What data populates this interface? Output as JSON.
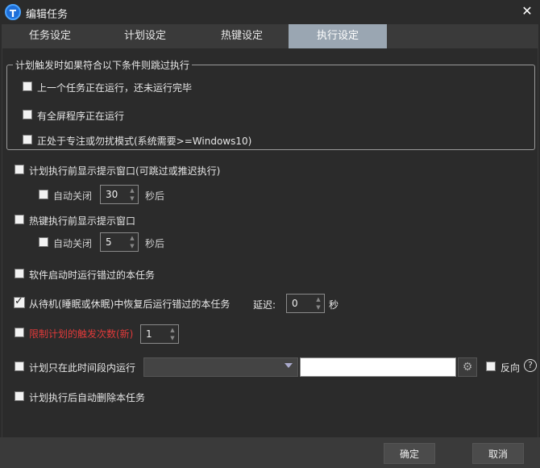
{
  "window": {
    "title": "编辑任务",
    "app_icon_letter": "T",
    "close_glyph": "✕"
  },
  "tabs": [
    {
      "label": "任务设定",
      "active": false
    },
    {
      "label": "计划设定",
      "active": false
    },
    {
      "label": "热键设定",
      "active": false
    },
    {
      "label": "执行设定",
      "active": true
    }
  ],
  "skip_group": {
    "legend": "计划触发时如果符合以下条件则跳过执行",
    "options": [
      {
        "label": "上一个任务正在运行，还未运行完毕",
        "checked": false
      },
      {
        "label": "有全屏程序正在运行",
        "checked": false
      },
      {
        "label": "正处于专注或勿扰模式(系统需要>=Windows10)",
        "checked": false
      }
    ]
  },
  "show_prompt_before_plan": {
    "label": "计划执行前显示提示窗口(可跳过或推迟执行)",
    "checked": false
  },
  "plan_auto_close": {
    "label": "自动关闭",
    "checked": false,
    "value": "30",
    "unit": "秒后"
  },
  "show_prompt_before_hotkey": {
    "label": "热键执行前显示提示窗口",
    "checked": false
  },
  "hotkey_auto_close": {
    "label": "自动关闭",
    "checked": false,
    "value": "5",
    "unit": "秒后"
  },
  "run_missed_on_start": {
    "label": "软件启动时运行错过的本任务",
    "checked": false
  },
  "run_missed_on_resume": {
    "label": "从待机(睡眠或休眠)中恢复后运行错过的本任务",
    "checked": true,
    "delay_label": "延迟:",
    "delay_value": "0",
    "delay_unit": "秒"
  },
  "limit_trigger_count": {
    "label": "限制计划的触发次数(新)",
    "checked": false,
    "value": "1",
    "color": "#e03a3a"
  },
  "time_window": {
    "label": "计划只在此时间段内运行",
    "checked": false,
    "dropdown_value": "",
    "text_value": "",
    "reverse_label": "反向",
    "help_glyph": "?"
  },
  "auto_delete": {
    "label": "计划执行后自动删除本任务",
    "checked": false
  },
  "footer": {
    "ok_label": "确定",
    "cancel_label": "取消"
  }
}
